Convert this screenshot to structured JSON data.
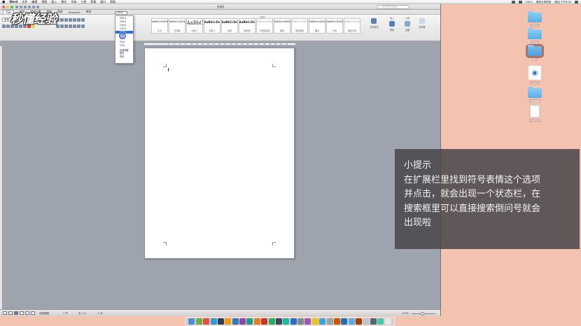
{
  "menubar": {
    "app": "Word",
    "items": [
      "文件",
      "编辑",
      "视图",
      "插入",
      "格式",
      "字体",
      "工具",
      "表格",
      "窗口",
      "帮助"
    ],
    "right": [
      "100%",
      "搜狗五笔拼音",
      "周四 下午3:00"
    ]
  },
  "window": {
    "title": "文档3",
    "search_placeholder": "在文档中搜索",
    "tabs": [
      "开始",
      "布局",
      "文档元素",
      "表格",
      "图表",
      "SmartArt",
      "审阅"
    ],
    "font_name": "宋体 (正文)",
    "styles_group_label": "样式",
    "styles": [
      {
        "sample": "AaBbCcDdEe",
        "name": "正文",
        "kind": "normal"
      },
      {
        "sample": "AaBbCcDdEe",
        "name": "无间隔",
        "kind": "normal"
      },
      {
        "sample": "AaBbC",
        "name": "标题 1",
        "kind": "big"
      },
      {
        "sample": "AaBbCcDc",
        "name": "标题 2",
        "kind": "mid"
      },
      {
        "sample": "AaBbCcDc",
        "name": "标题",
        "kind": "mid"
      },
      {
        "sample": "AaBbCcDc",
        "name": "副标题",
        "kind": "mid"
      },
      {
        "sample": "AaBbCcDdEe",
        "name": "不明显强调",
        "kind": "light"
      },
      {
        "sample": "AaBbCcDdEe",
        "name": "强调",
        "kind": "normal"
      },
      {
        "sample": "AaBbCcDdEe",
        "name": "明显强调",
        "kind": "light"
      },
      {
        "sample": "AaBbCcDdEe",
        "name": "要点",
        "kind": "normal"
      },
      {
        "sample": "AaBbCcDdEe",
        "name": "引用",
        "kind": "normal"
      },
      {
        "sample": "AaBbCcDdEe",
        "name": "明显引用",
        "kind": "light"
      }
    ],
    "ribbon_right": [
      {
        "group": "",
        "label": "文本样式"
      },
      {
        "group": "插入",
        "label": "形状"
      },
      {
        "group": "主题",
        "label": "主题"
      },
      {
        "group": "",
        "label": "文本框"
      }
    ],
    "zoom": {
      "current": "125%",
      "options": [
        "500%",
        "200%",
        "150%",
        "125%",
        "100%",
        "75%",
        "50%",
        "25%",
        "10%",
        "页面宽度",
        "整页",
        "双页"
      ],
      "selected_index": 4
    },
    "ruler_ticks": [
      "2",
      "4",
      "6",
      "8",
      "10",
      "12",
      "14",
      "16",
      "18",
      "20",
      "22",
      "24",
      "26",
      "28",
      "30",
      "32",
      "34",
      "36",
      "38",
      "40",
      "42",
      "44"
    ],
    "status": {
      "view": "页面视图",
      "sec": "1 节",
      "page": "页: 1/1",
      "words": "0 字",
      "zoom": "110%"
    }
  },
  "watermark_logo": "秒懂经验",
  "tips": {
    "title": "小提示",
    "lines": [
      "在扩展栏里找到符号表情这个选项",
      "并点击，就会出现一个状态栏，在",
      "搜索框里可以直接搜索倒问号就会",
      "出现啦"
    ]
  },
  "desktop": [
    {
      "type": "folder",
      "label": "文件夹"
    },
    {
      "type": "folder",
      "label": "文件夹"
    },
    {
      "type": "folder",
      "label": "图片",
      "selected": true
    },
    {
      "type": "qq",
      "label": "QQ文件"
    },
    {
      "type": "folder",
      "label": "资料整理"
    },
    {
      "type": "file",
      "label": "Untitled"
    }
  ],
  "dock_colors": [
    "#4a90d9",
    "#6ab04c",
    "#e74c3c",
    "#3498db",
    "#2c3e50",
    "#f39c12",
    "#2980b9",
    "#8e44ad",
    "#16a085",
    "#e67e22",
    "#c0392b",
    "#27ae60",
    "#34495e",
    "#1abc9c",
    "#2d6bd1",
    "#7f8c8d",
    "#9b59b6",
    "#f1c40f",
    "#3aa3e3",
    "#95a5a6",
    "#d35400",
    "#1f6fb2",
    "#5dade2",
    "#a04000",
    "#bdc3c7",
    "#566573",
    "#48c9b0",
    "#e8e8e8"
  ]
}
